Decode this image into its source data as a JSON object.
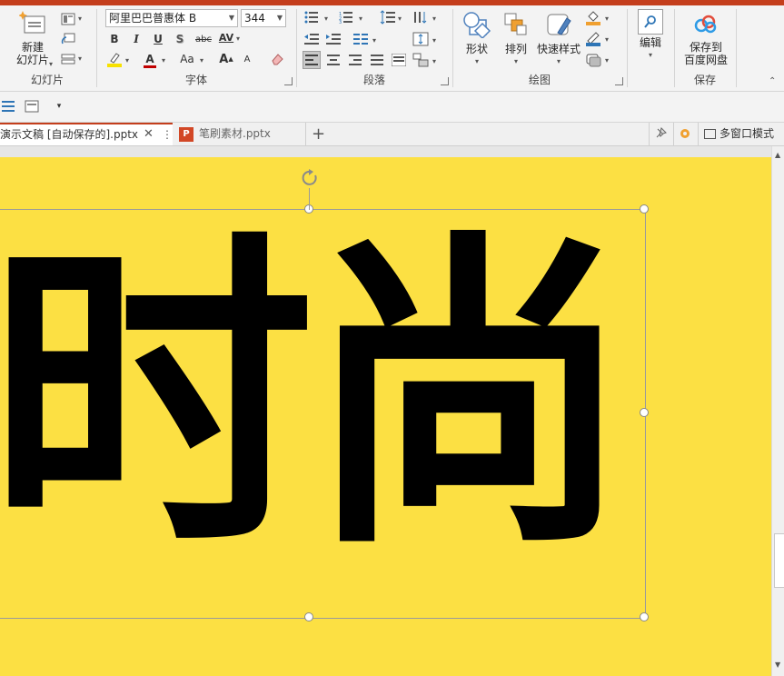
{
  "ribbon": {
    "slides_group": {
      "new_slide": "新建\n幻灯片",
      "label": "幻灯片"
    },
    "font_group": {
      "font_name": "阿里巴巴普惠体 B",
      "font_size": "344",
      "label": "字体",
      "bold": "B",
      "italic": "I",
      "underline": "U",
      "shadow": "S",
      "strike": "abc",
      "spacing": "AV",
      "grow": "A",
      "shrink": "A",
      "case": "Aa"
    },
    "paragraph_group": {
      "label": "段落"
    },
    "drawing_group": {
      "shapes": "形状",
      "arrange": "排列",
      "quick_styles": "快速样式",
      "label": "绘图"
    },
    "edit_group": {
      "edit": "编辑"
    },
    "save_group": {
      "save_to_baidu": "保存到\n百度网盘",
      "label": "保存"
    }
  },
  "tabs": [
    {
      "label": "演示文稿  [自动保存的].pptx"
    },
    {
      "label": "笔刷素材.pptx"
    }
  ],
  "tabbar": {
    "multiwindow": "多窗口模式"
  },
  "slide": {
    "text": "时尚",
    "background": "#fce043"
  },
  "colors": {
    "accent": "#c43e1c",
    "slide_bg": "#fce043"
  }
}
